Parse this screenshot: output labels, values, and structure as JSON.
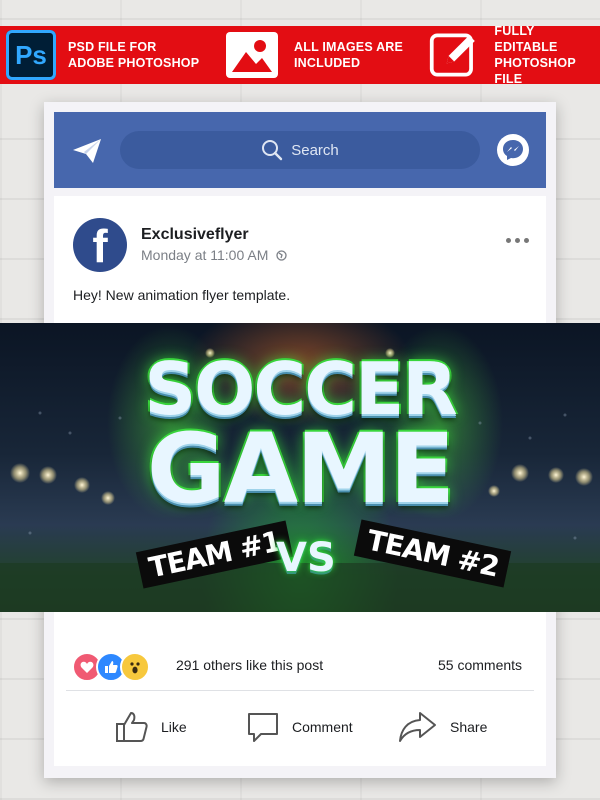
{
  "banner": {
    "items": [
      {
        "label": "PSD FILE FOR\nADOBE PHOTOSHOP",
        "icon": "photoshop-logo-icon"
      },
      {
        "label": "ALL IMAGES ARE\nINCLUDED",
        "icon": "image-icon"
      },
      {
        "label": "FULLY EDITABLE\nPHOTOSHOP FILE",
        "icon": "edit-pencil-icon"
      }
    ],
    "ps_logo_text": "Ps",
    "color": "#e30d13"
  },
  "header": {
    "search_placeholder": "Search",
    "color": "#4767ad"
  },
  "post": {
    "author": "Exclusiveflyer",
    "avatar_letter": "f",
    "time": "Monday at 11:00 AM",
    "caption": "Hey! New animation flyer template."
  },
  "flyer": {
    "line1": "SOCCER",
    "line2": "GAME",
    "team1": "TEAM #1",
    "vs": "VS",
    "team2": "TEAM #2"
  },
  "engagement": {
    "likes_text": "291 others like this post",
    "comments_text": "55 comments",
    "reactions": [
      "love-icon",
      "like-icon",
      "wow-icon"
    ]
  },
  "actions": {
    "like": "Like",
    "comment": "Comment",
    "share": "Share"
  }
}
